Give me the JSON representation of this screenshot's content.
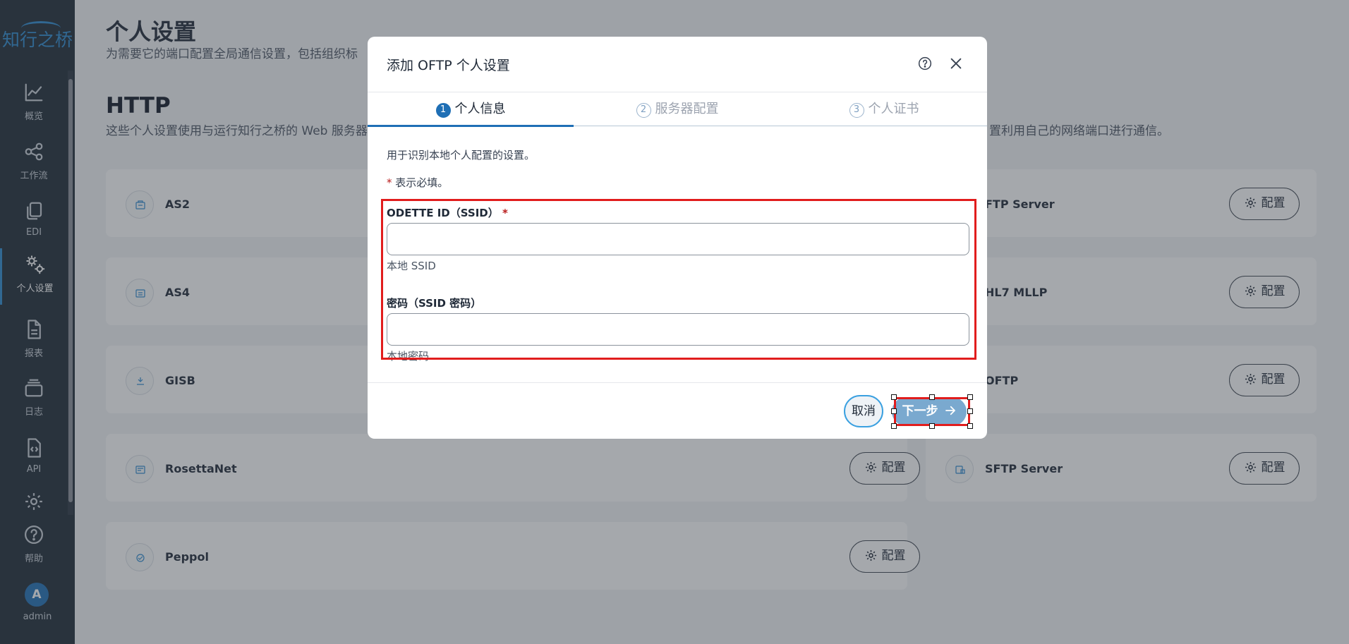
{
  "app": {
    "logo_text": "知行之桥",
    "brand_color": "#2d8ad0"
  },
  "sidebar": {
    "items": [
      {
        "label": "概览",
        "icon": "chart-line-icon"
      },
      {
        "label": "工作流",
        "icon": "share-nodes-icon"
      },
      {
        "label": "EDI",
        "icon": "copy-icon"
      },
      {
        "label": "个人设置",
        "icon": "gears-icon",
        "active": true
      },
      {
        "label": "报表",
        "icon": "document-icon"
      },
      {
        "label": "日志",
        "icon": "stack-icon"
      },
      {
        "label": "API",
        "icon": "code-file-icon"
      },
      {
        "label": "",
        "icon": "gear-icon"
      },
      {
        "label": "帮助",
        "icon": "question-circle-icon"
      }
    ],
    "user": {
      "initial": "A",
      "name": "admin"
    }
  },
  "page": {
    "title": "个人设置",
    "subtitle": "为需要它的端口配置全局通信设置，包括组织标",
    "section_title": "HTTP",
    "section_subtitle": "这些个人设置使用与运行知行之桥的 Web 服务器",
    "section_subtitle_right": "置利用自己的网络端口进行通信。"
  },
  "cards": {
    "left": [
      {
        "name": "AS2"
      },
      {
        "name": "AS4"
      },
      {
        "name": "GISB"
      },
      {
        "name": "RosettaNet",
        "config_label": "配置"
      },
      {
        "name": "Peppol",
        "config_label": "配置"
      }
    ],
    "right": [
      {
        "name": "FTP Server",
        "config_label": "配置"
      },
      {
        "name": "HL7 MLLP",
        "config_label": "配置"
      },
      {
        "name": "OFTP",
        "config_label": "配置"
      },
      {
        "name": "SFTP Server",
        "config_label": "配置"
      }
    ]
  },
  "modal": {
    "title": "添加 OFTP 个人设置",
    "steps": [
      {
        "num": "1",
        "label": "个人信息",
        "active": true
      },
      {
        "num": "2",
        "label": "服务器配置"
      },
      {
        "num": "3",
        "label": "个人证书"
      }
    ],
    "description": "用于识别本地个人配置的设置。",
    "required_star": "*",
    "required_note": " 表示必填。",
    "fields": [
      {
        "label": "ODETTE ID（SSID）",
        "required": true,
        "value": "",
        "help": "本地 SSID"
      },
      {
        "label": "密码（SSID 密码）",
        "required": false,
        "value": "",
        "help": "本地密码"
      }
    ],
    "cancel_label": "取消",
    "next_label": "下一步"
  }
}
